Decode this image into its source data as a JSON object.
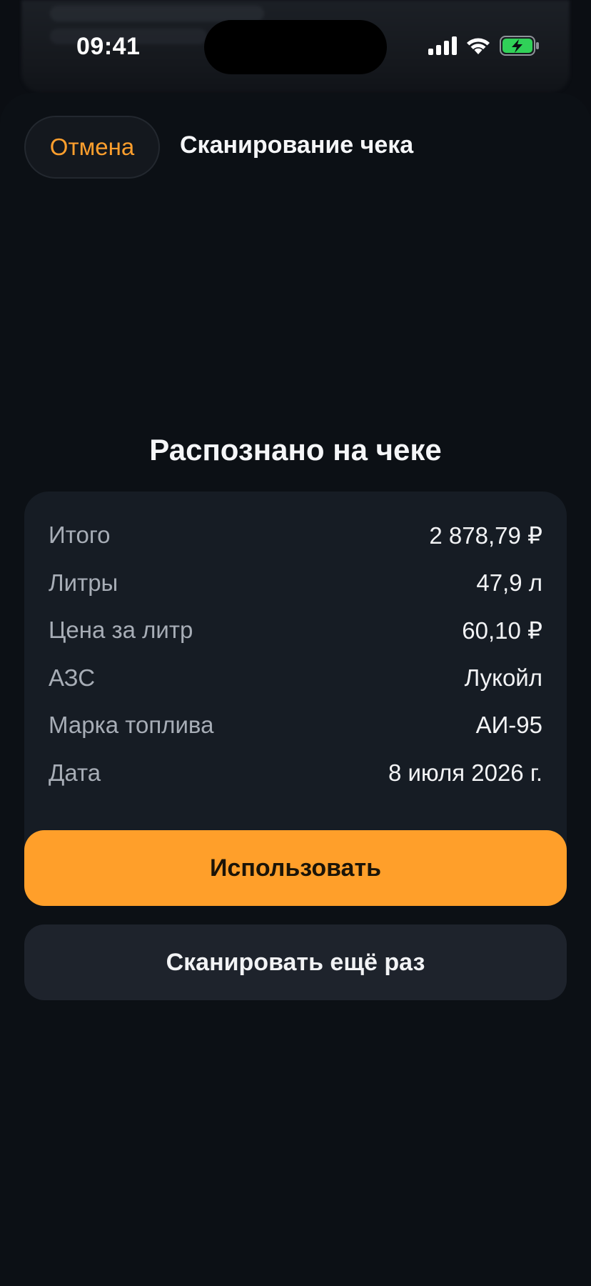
{
  "status_bar": {
    "time": "09:41",
    "icons": [
      "cellular-signal-icon",
      "wifi-icon",
      "battery-charging-icon"
    ],
    "battery_color": "#30d158"
  },
  "header": {
    "cancel_label": "Отмена",
    "title": "Сканирование чека"
  },
  "result": {
    "section_title": "Распознано на чеке",
    "rows": [
      {
        "label": "Итого",
        "value": "2 878,79 ₽"
      },
      {
        "label": "Литры",
        "value": "47,9 л"
      },
      {
        "label": "Цена за литр",
        "value": "60,10 ₽"
      },
      {
        "label": "АЗС",
        "value": "Лукойл"
      },
      {
        "label": "Марка топлива",
        "value": "АИ-95"
      },
      {
        "label": "Дата",
        "value": "8 июля 2026 г."
      }
    ]
  },
  "actions": {
    "use_label": "Использовать",
    "rescan_label": "Сканировать ещё раз"
  },
  "colors": {
    "accent": "#ff9f2a",
    "background": "#0b0e13",
    "card": "#161c24"
  }
}
